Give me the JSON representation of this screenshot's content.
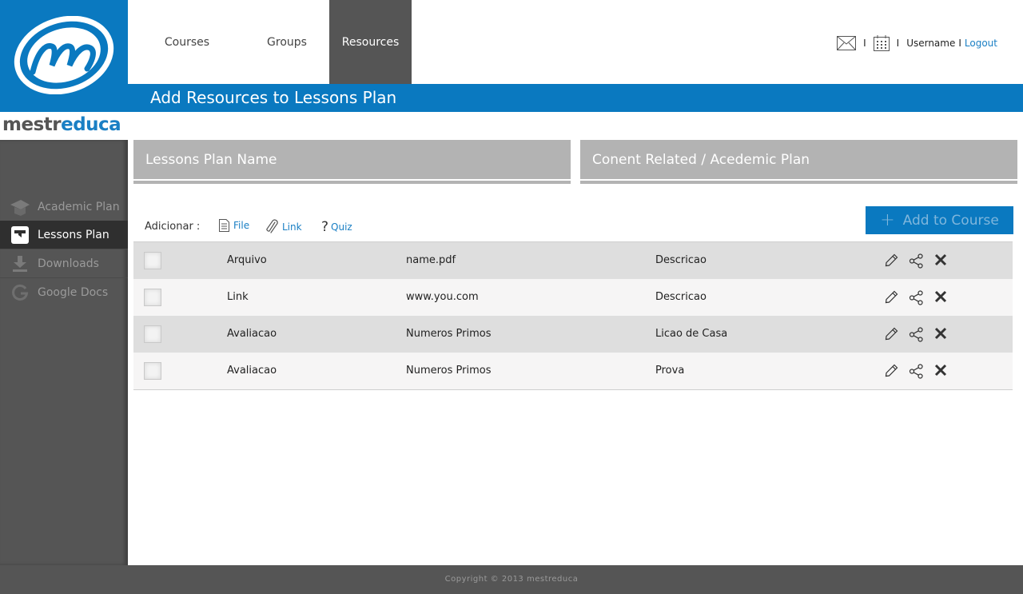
{
  "brand": {
    "part1": "mestr",
    "part2": "educa"
  },
  "nav": {
    "courses": "Courses",
    "groups": "Groups",
    "resources": "Resources"
  },
  "user": {
    "sep1": "I",
    "sep2": "I",
    "username": "Username",
    "sep3": "I",
    "logout": "Logout"
  },
  "page_title": "Add Resources to Lessons Plan",
  "sidebar": {
    "items": [
      {
        "label": "Academic Plan",
        "icon": "graduation-cap-icon"
      },
      {
        "label": "Lessons Plan",
        "icon": "lessons-plan-icon"
      },
      {
        "label": "Downloads",
        "icon": "download-icon"
      },
      {
        "label": "Google Docs",
        "icon": "google-icon"
      }
    ]
  },
  "panels": {
    "left": "Lessons Plan Name",
    "right": "Conent Related / Acedemic Plan"
  },
  "toolbar": {
    "adicionar": "Adicionar :",
    "file": "File",
    "link": "Link",
    "quiz": "Quiz",
    "quiz_icon": "?",
    "add_to_course": "Add to Course",
    "add_plus": "+"
  },
  "table": {
    "rows": [
      {
        "type": "Arquivo",
        "name": "name.pdf",
        "desc": "Descricao"
      },
      {
        "type": "Link",
        "name": "www.you.com",
        "desc": "Descricao"
      },
      {
        "type": "Avaliacao",
        "name": "Numeros Primos",
        "desc": "Licao de Casa"
      },
      {
        "type": "Avaliacao",
        "name": "Numeros Primos",
        "desc": "Prova"
      }
    ]
  },
  "footer": "Copyright © 2013 mestreduca",
  "colors": {
    "brand_blue": "#0a79c0",
    "dark_gray": "#555555",
    "panel_gray": "#b3b3b3"
  }
}
